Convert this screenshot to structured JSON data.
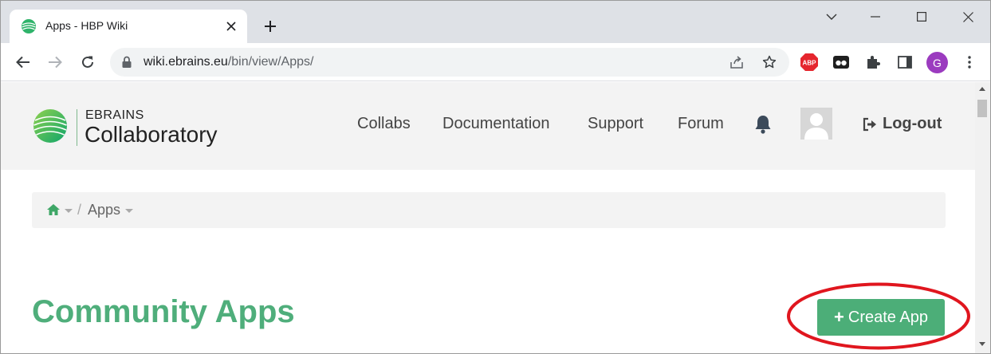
{
  "browser": {
    "tab": {
      "title": "Apps - HBP Wiki",
      "favicon": "ebrains-leaf-icon"
    },
    "new_tab_label": "+",
    "url": {
      "host": "wiki.ebrains.eu",
      "path": "/bin/view/Apps/"
    },
    "profile_initial": "G",
    "extensions": [
      "adblock-icon",
      "extension-dark-icon",
      "puzzle-icon",
      "side-panel-icon"
    ],
    "adblock_label": "ABP"
  },
  "header": {
    "brand_top": "EBRAINS",
    "brand_main": "Collaboratory",
    "nav": [
      "Collabs",
      "Documentation",
      "Support",
      "Forum"
    ],
    "logout_label": "Log-out"
  },
  "breadcrumb": {
    "separator": "/",
    "current": "Apps"
  },
  "main": {
    "title": "Community Apps",
    "create_button": {
      "icon": "+",
      "label": "Create App"
    }
  },
  "colors": {
    "accent_green": "#4cae78",
    "title_green": "#4fae7b",
    "annotation_red": "#e0161e"
  }
}
